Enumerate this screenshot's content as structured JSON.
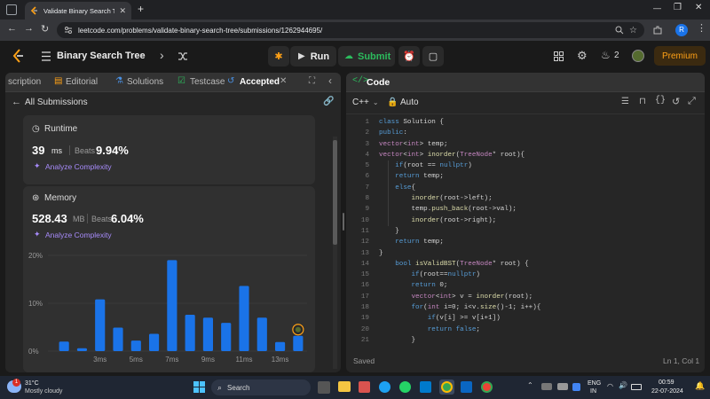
{
  "browser": {
    "tab_title": "Validate Binary Search Tree - Leetc",
    "url": "leetcode.com/problems/validate-binary-search-tree/submissions/1262944695/",
    "profile_initial": "R"
  },
  "header": {
    "problem_title": "Binary Search Tree",
    "run_label": "Run",
    "submit_label": "Submit",
    "streak_count": "2",
    "premium_label": "Premium"
  },
  "left_panel": {
    "tabs": [
      {
        "label": "scription"
      },
      {
        "label": "Editorial"
      },
      {
        "label": "Solutions"
      },
      {
        "label": "Testcase"
      },
      {
        "label": "Accepted"
      }
    ],
    "back_label": "All Submissions",
    "runtime": {
      "title": "Runtime",
      "value": "39",
      "unit": "ms",
      "beats_label": "Beats",
      "beats_value": "9.94%",
      "analyze_label": "Analyze Complexity"
    },
    "memory": {
      "title": "Memory",
      "value": "528.43",
      "unit": "MB",
      "beats_label": "Beats",
      "beats_value": "6.04%",
      "analyze_label": "Analyze Complexity"
    }
  },
  "chart_data": {
    "type": "bar",
    "y_tick_labels": [
      "20%",
      "10%",
      "0%"
    ],
    "x_tick_labels": [
      "3ms",
      "5ms",
      "7ms",
      "9ms",
      "11ms",
      "13ms"
    ],
    "ylim": [
      0,
      20
    ],
    "values": [
      2.0,
      0.6,
      10.8,
      4.9,
      2.2,
      3.6,
      19.0,
      7.6,
      7.0,
      5.9,
      13.6,
      7.0,
      1.9,
      3.2
    ],
    "highlight_index": 13,
    "bar_color": "#1a73e8"
  },
  "code_panel": {
    "title": "Code",
    "language": "C++",
    "mode": "Auto",
    "status": "Saved",
    "cursor": "Ln 1, Col 1",
    "lines": [
      "class Solution {",
      "public:",
      "vector<int> temp;",
      "vector<int> inorder(TreeNode* root){",
      "    if(root == nullptr)",
      "    return temp;",
      "    else{",
      "        inorder(root->left);",
      "        temp.push_back(root->val);",
      "        inorder(root->right);",
      "    }",
      "    return temp;",
      "}",
      "    bool isValidBST(TreeNode* root) {",
      "        if(root==nullptr)",
      "        return 0;",
      "        vector<int> v = inorder(root);",
      "        for(int i=0; i<v.size()-1; i++){",
      "            if(v[i] >= v[i+1])",
      "            return false;",
      "        }"
    ]
  },
  "taskbar": {
    "weather_temp": "31°C",
    "weather_desc": "Mostly cloudy",
    "weather_badge": "1",
    "search_placeholder": "Search",
    "lang_top": "ENG",
    "lang_bottom": "IN",
    "time": "00:59",
    "date": "22-07-2024"
  }
}
